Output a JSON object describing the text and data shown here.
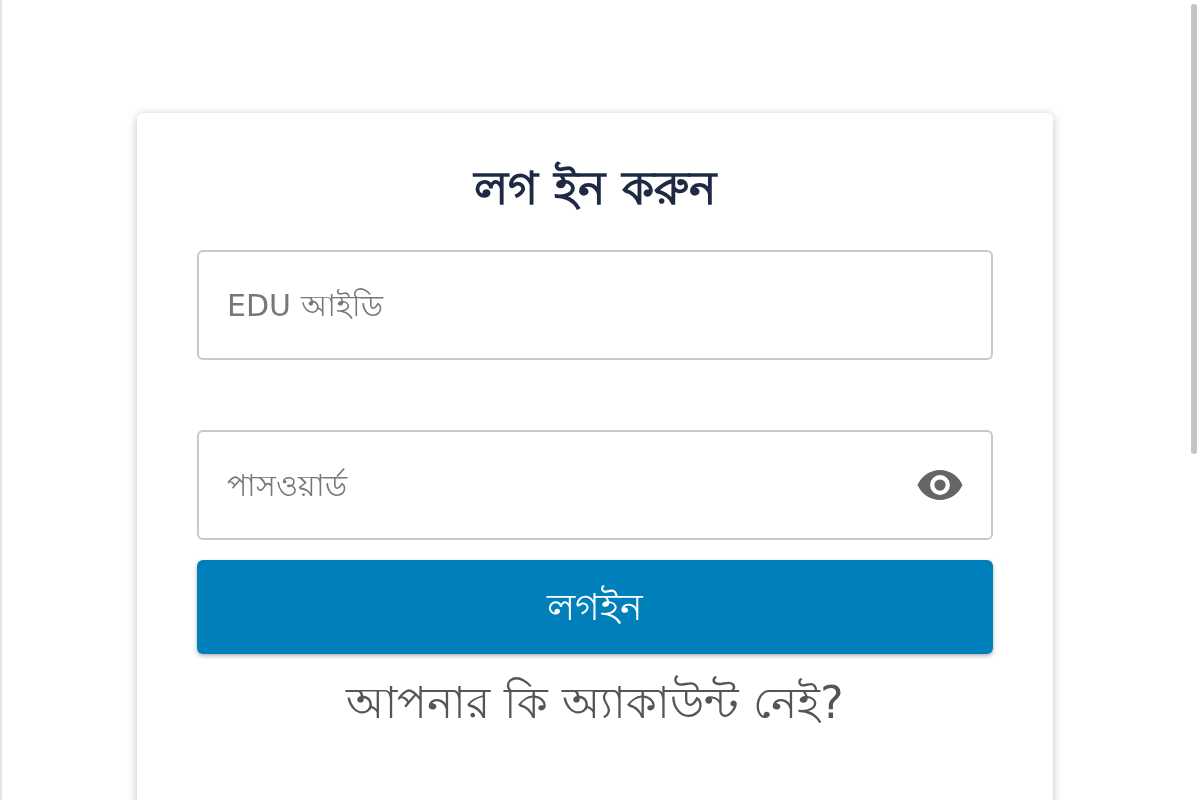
{
  "login_card": {
    "title": "লগ ইন করুন",
    "id_field": {
      "placeholder": "EDU আইডি"
    },
    "password_field": {
      "placeholder": "পাসওয়ার্ড"
    },
    "login_button": "লগইন",
    "signup_prompt": "আপনার কি অ্যাকাউন্ট নেই?"
  }
}
